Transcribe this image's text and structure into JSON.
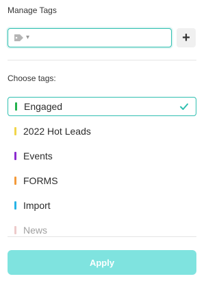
{
  "header": {
    "title": "Manage Tags"
  },
  "tag_input": {
    "value": "",
    "caret": "▾"
  },
  "add_button": {
    "label": "+"
  },
  "choose": {
    "label": "Choose tags:"
  },
  "tags": [
    {
      "label": "Engaged",
      "color": "#22b14c",
      "selected": true
    },
    {
      "label": "2022 Hot Leads",
      "color": "#f1d54a",
      "selected": false
    },
    {
      "label": "Events",
      "color": "#8b2bcf",
      "selected": false
    },
    {
      "label": "FORMS",
      "color": "#f39a3a",
      "selected": false
    },
    {
      "label": "Import",
      "color": "#27b3e6",
      "selected": false
    },
    {
      "label": "News",
      "color": "#d98b8b",
      "selected": false
    }
  ],
  "apply_button": {
    "label": "Apply",
    "color": "#7fe3df"
  }
}
